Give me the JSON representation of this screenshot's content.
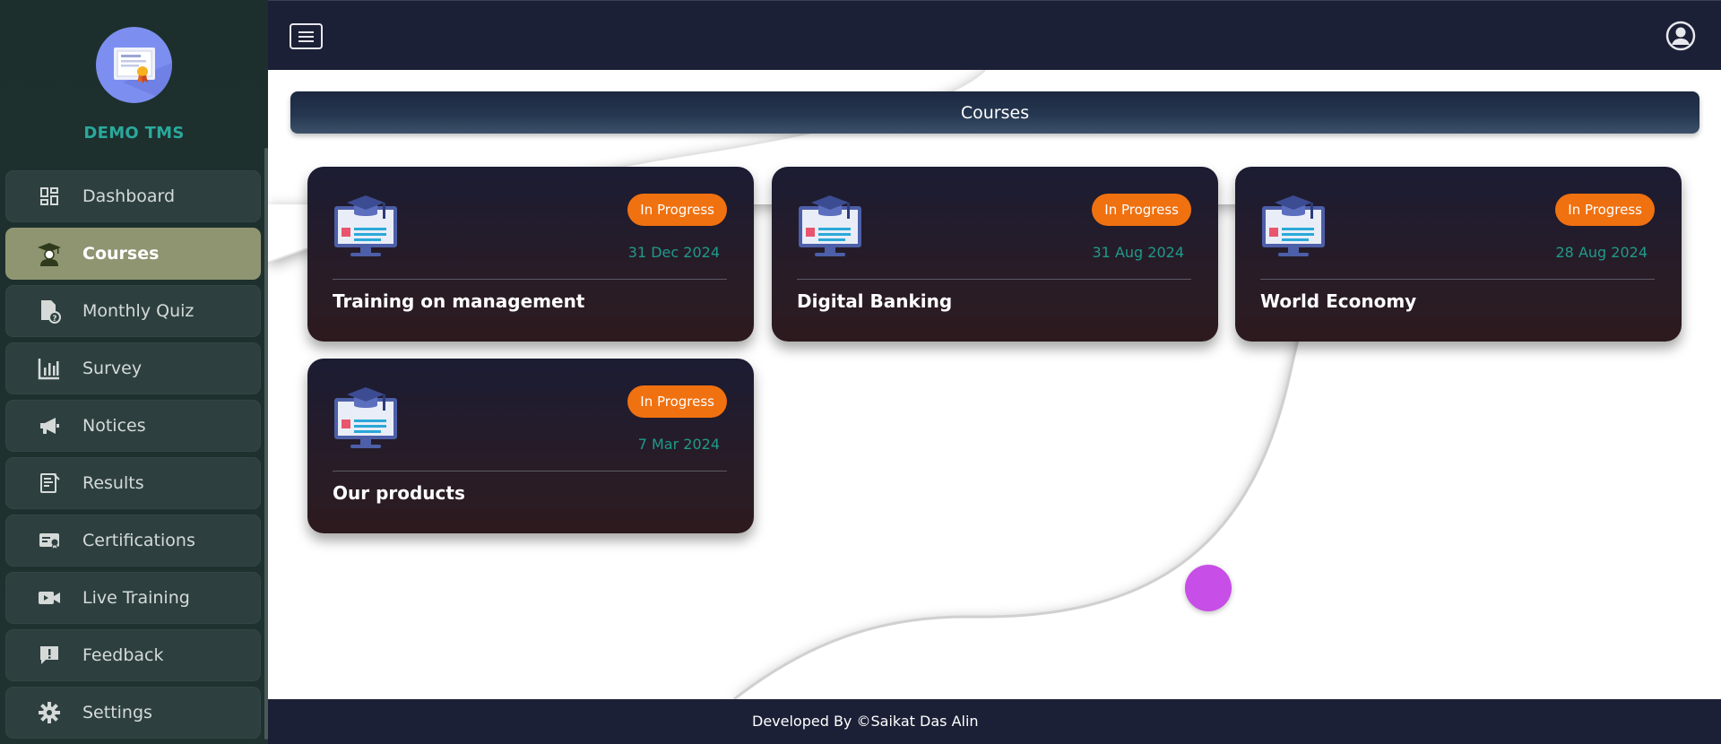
{
  "app": {
    "brand": "DEMO TMS"
  },
  "sidebar": {
    "items": [
      {
        "label": "Dashboard",
        "icon": "dashboard-icon",
        "active": false
      },
      {
        "label": "Courses",
        "icon": "graduate-icon",
        "active": true
      },
      {
        "label": "Monthly Quiz",
        "icon": "quiz-icon",
        "active": false
      },
      {
        "label": "Survey",
        "icon": "bar-chart-icon",
        "active": false
      },
      {
        "label": "Notices",
        "icon": "megaphone-icon",
        "active": false
      },
      {
        "label": "Results",
        "icon": "results-icon",
        "active": false
      },
      {
        "label": "Certifications",
        "icon": "certificate-icon",
        "active": false
      },
      {
        "label": "Live Training",
        "icon": "video-icon",
        "active": false
      },
      {
        "label": "Feedback",
        "icon": "feedback-icon",
        "active": false
      },
      {
        "label": "Settings",
        "icon": "gear-icon",
        "active": false
      }
    ]
  },
  "header": {
    "menu_icon": "hamburger-icon",
    "user_icon": "user-circle-icon"
  },
  "page": {
    "title": "Courses"
  },
  "courses": [
    {
      "title": "Training on management",
      "status": "In Progress",
      "date": "31 Dec 2024"
    },
    {
      "title": "Digital Banking",
      "status": "In Progress",
      "date": "31 Aug 2024"
    },
    {
      "title": "World Economy",
      "status": "In Progress",
      "date": "28 Aug 2024"
    },
    {
      "title": "Our products",
      "status": "In Progress",
      "date": "7 Mar 2024"
    }
  ],
  "footer": {
    "text": "Developed By ©Saikat Das Alin"
  },
  "colors": {
    "accent": "#2aa99c",
    "active_nav": "#8f9471",
    "badge": "#f07110",
    "fab": "#c74ee6"
  }
}
